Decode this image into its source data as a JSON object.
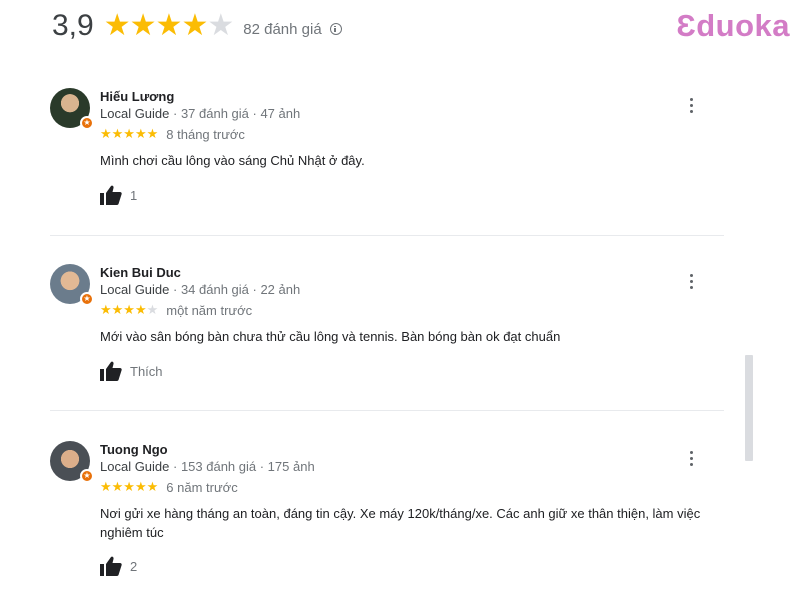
{
  "summary": {
    "rating": "3,9",
    "stars": 4,
    "count_label": "82 đánh giá"
  },
  "brand": {
    "logo_text": "Ɛduoka",
    "color": "#d37cc6"
  },
  "colors": {
    "star": "#fbbc04",
    "star_empty": "#dadce0",
    "badge": "#e8710a"
  },
  "reviews": [
    {
      "name": "Hiếu Lương",
      "guide": "Local Guide",
      "stats": " · 37 đánh giá · 47 ảnh",
      "stars": 5,
      "time": "8 tháng trước",
      "text": "Mình chơi cầu lông vào sáng Chủ Nhật ở đây.",
      "likes": "1"
    },
    {
      "name": "Kien Bui Duc",
      "guide": "Local Guide",
      "stats": " · 34 đánh giá · 22 ảnh",
      "stars": 4,
      "time": "một năm trước",
      "text": "Mới vào sân bóng bàn chưa thử cầu lông và tennis. Bàn bóng bàn ok đạt chuẩn",
      "likes": "Thích"
    },
    {
      "name": "Tuong Ngo",
      "guide": "Local Guide",
      "stats": " · 153 đánh giá · 175 ảnh",
      "stars": 5,
      "time": "6 năm trước",
      "text": "Nơi gửi xe hàng tháng an toàn, đáng tin cậy. Xe máy 120k/tháng/xe. Các anh giữ xe thân thiện, làm việc nghiêm túc",
      "likes": "2"
    }
  ]
}
